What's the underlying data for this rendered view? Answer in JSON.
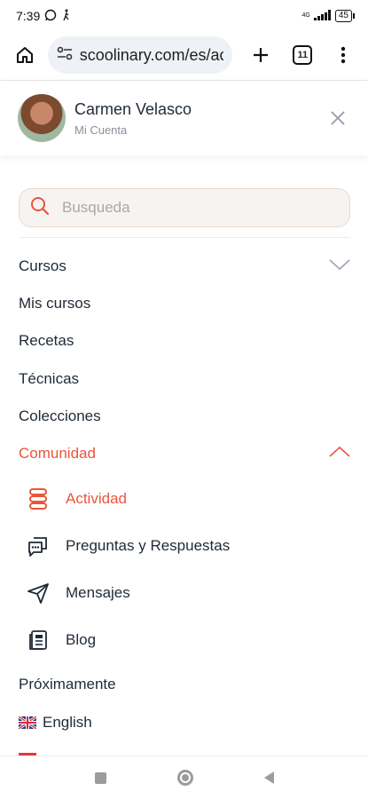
{
  "status_bar": {
    "time": "7:39",
    "network": "4G",
    "battery": "45"
  },
  "browser": {
    "url": "scoolinary.com/es/ac",
    "tab_count": "11"
  },
  "profile": {
    "name": "Carmen Velasco",
    "subtitle": "Mi Cuenta"
  },
  "search": {
    "placeholder": "Busqueda"
  },
  "menu": {
    "items": [
      {
        "label": "Cursos"
      },
      {
        "label": "Mis cursos"
      },
      {
        "label": "Recetas"
      },
      {
        "label": "Técnicas"
      },
      {
        "label": "Colecciones"
      },
      {
        "label": "Comunidad"
      }
    ],
    "community_items": [
      {
        "label": "Actividad",
        "icon": "activity-icon"
      },
      {
        "label": "Preguntas y Respuestas",
        "icon": "questions-icon"
      },
      {
        "label": "Mensajes",
        "icon": "send-icon"
      },
      {
        "label": "Blog",
        "icon": "blog-icon"
      }
    ],
    "upcoming": "Próximamente",
    "language": "English"
  },
  "colors": {
    "accent": "#e8563a",
    "text": "#1f2a37"
  }
}
